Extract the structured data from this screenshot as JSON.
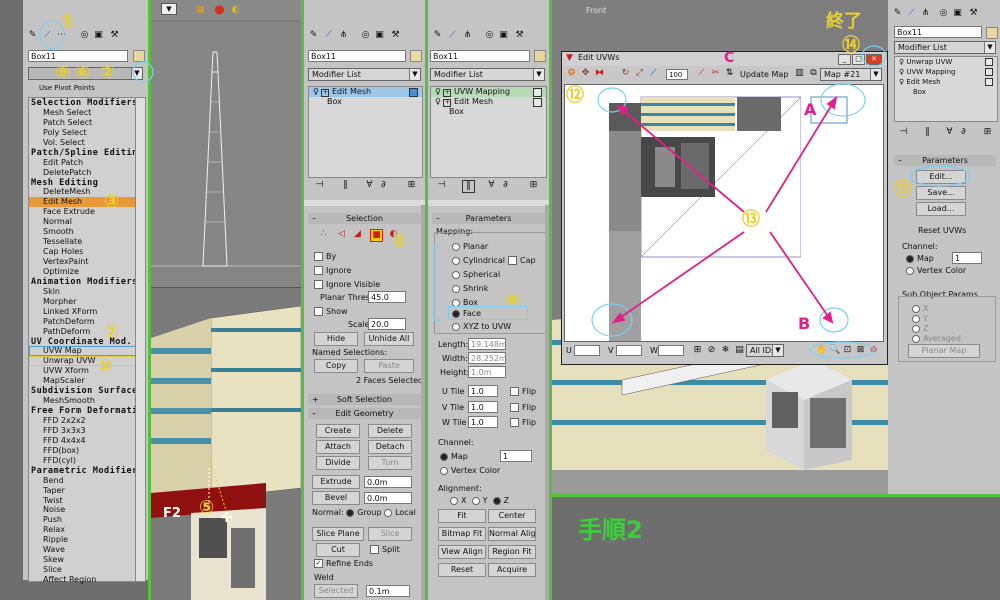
{
  "panel1": {
    "object_name": "Box11",
    "modifier_list": "",
    "pivot_button": "Use Pivot Points",
    "list_items": [
      {
        "label": "Selection Modifiers",
        "type": "header"
      },
      {
        "label": "Mesh Select",
        "type": "item"
      },
      {
        "label": "Patch Select",
        "type": "item"
      },
      {
        "label": "Poly Select",
        "type": "item"
      },
      {
        "label": "Vol. Select",
        "type": "item"
      },
      {
        "label": "Patch/Spline Editing",
        "type": "header"
      },
      {
        "label": "Edit Patch",
        "type": "item"
      },
      {
        "label": "DeletePatch",
        "type": "item"
      },
      {
        "label": "Mesh Editing",
        "type": "header"
      },
      {
        "label": "DeleteMesh",
        "type": "item"
      },
      {
        "label": "Edit Mesh",
        "type": "selected"
      },
      {
        "label": "Face Extrude",
        "type": "item"
      },
      {
        "label": "Normal",
        "type": "item"
      },
      {
        "label": "Smooth",
        "type": "item"
      },
      {
        "label": "Tessellate",
        "type": "item"
      },
      {
        "label": "Cap Holes",
        "type": "item"
      },
      {
        "label": "VertexPaint",
        "type": "item"
      },
      {
        "label": "Optimize",
        "type": "item"
      },
      {
        "label": "Animation Modifiers",
        "type": "header"
      },
      {
        "label": "Skin",
        "type": "item"
      },
      {
        "label": "Morpher",
        "type": "item"
      },
      {
        "label": "Linked XForm",
        "type": "item"
      },
      {
        "label": "PatchDeform",
        "type": "item"
      },
      {
        "label": "PathDeform",
        "type": "item"
      },
      {
        "label": "UV Coordinate Mod.",
        "type": "header"
      },
      {
        "label": "UVW Map",
        "type": "boxed"
      },
      {
        "label": "Unwrap UVW",
        "type": "boxed-yellow"
      },
      {
        "label": "UVW Xform",
        "type": "item"
      },
      {
        "label": "MapScaler",
        "type": "item"
      },
      {
        "label": "Subdivision Surfaces",
        "type": "header"
      },
      {
        "label": "MeshSmooth",
        "type": "item"
      },
      {
        "label": "Free Form Deformations",
        "type": "header"
      },
      {
        "label": "FFD 2x2x2",
        "type": "item"
      },
      {
        "label": "FFD 3x3x3",
        "type": "item"
      },
      {
        "label": "FFD 4x4x4",
        "type": "item"
      },
      {
        "label": "FFD(box)",
        "type": "item"
      },
      {
        "label": "FFD(cyl)",
        "type": "item"
      },
      {
        "label": "Parametric Modifiers",
        "type": "header"
      },
      {
        "label": "Bend",
        "type": "item"
      },
      {
        "label": "Taper",
        "type": "item"
      },
      {
        "label": "Twist",
        "type": "item"
      },
      {
        "label": "Noise",
        "type": "item"
      },
      {
        "label": "Push",
        "type": "item"
      },
      {
        "label": "Relax",
        "type": "item"
      },
      {
        "label": "Ripple",
        "type": "item"
      },
      {
        "label": "Wave",
        "type": "item"
      },
      {
        "label": "Skew",
        "type": "item"
      },
      {
        "label": "Slice",
        "type": "item"
      },
      {
        "label": "Affect Region",
        "type": "item"
      }
    ]
  },
  "panel3": {
    "object_name": "Box11",
    "modifier_list": "Modifier List",
    "stack": [
      "Edit Mesh",
      "Box"
    ],
    "selection_rollout": "Selection",
    "by_label": "By",
    "ignore_label": "Ignore",
    "ignore_visible_label": "Ignore Visible",
    "planar_thresh_label": "Planar Thresh",
    "planar_thresh_value": "45.0",
    "show_label": "Show",
    "scale_label": "Scale",
    "scale_value": "20.0",
    "hide": "Hide",
    "unhide_all": "Unhide All",
    "named_selections": "Named Selections:",
    "copy": "Copy",
    "paste": "Paste",
    "faces_selected": "2 Faces Selected",
    "soft_selection": "Soft Selection",
    "edit_geometry": "Edit Geometry",
    "create": "Create",
    "delete": "Delete",
    "attach": "Attach",
    "detach": "Detach",
    "divide": "Divide",
    "turn": "Turn",
    "extrude": "Extrude",
    "extrude_value": "0.0m",
    "bevel": "Bevel",
    "bevel_value": "0.0m",
    "normal_label": "Normal:",
    "group": "Group",
    "local": "Local",
    "slice_plane": "Slice Plane",
    "slice": "Slice",
    "cut": "Cut",
    "split": "Split",
    "refine_ends": "Refine Ends",
    "weld": "Weld",
    "selected": "Selected",
    "weld_value": "0.1m"
  },
  "panel4": {
    "object_name": "Box11",
    "modifier_list": "Modifier List",
    "stack": [
      "UVW Mapping",
      "Edit Mesh",
      "Box"
    ],
    "parameters": "Parameters",
    "mapping": "Mapping:",
    "planar": "Planar",
    "cylindrical": "Cylindrical",
    "cap": "Cap",
    "spherical": "Spherical",
    "shrink": "Shrink",
    "box": "Box",
    "face": "Face",
    "xyz_to_uvw": "XYZ to UVW",
    "length_label": "Length:",
    "length_value": "19.148m",
    "width_label": "Width:",
    "width_value": "28.252m",
    "height_label": "Height:",
    "height_value": "1.0m",
    "utile": "U Tile",
    "vtile": "V Tile",
    "wtile": "W Tile",
    "tile_value": "1.0",
    "flip": "Flip",
    "channel": "Channel:",
    "map": "Map",
    "map_value": "1",
    "vertex_color": "Vertex Color",
    "alignment": "Alignment:",
    "x": "X",
    "y": "Y",
    "z": "Z",
    "fit": "Fit",
    "center": "Center",
    "bitmap_fit": "Bitmap Fit",
    "normal_align": "Normal Align",
    "view_align": "View Align",
    "region_fit": "Region Fit",
    "reset": "Reset",
    "acquire": "Acquire"
  },
  "viewport5": {
    "label": "Front"
  },
  "unwrap": {
    "title": "Edit UVWs",
    "update_map": "Update Map",
    "map_dropdown": "Map #21",
    "zoom_value": "100",
    "u_label": "U",
    "v_label": "V",
    "w_label": "W",
    "all_ids": "All IDs"
  },
  "panel6": {
    "object_name": "Box11",
    "modifier_list": "Modifier List",
    "stack": [
      "Unwrap UVW",
      "UVW Mapping",
      "Edit Mesh",
      "Box"
    ],
    "parameters": "Parameters",
    "edit": "Edit...",
    "save": "Save...",
    "load": "Load...",
    "reset_uvws": "Reset UVWs",
    "channel": "Channel:",
    "map": "Map",
    "map_value": "1",
    "vertex_color": "Vertex Color",
    "sub_object_params": "Sub Object Params",
    "x": "X",
    "y": "Y",
    "z": "Z",
    "averaged": "Averaged",
    "planar_map": "Planar Map"
  },
  "annotations": {
    "n1": "①",
    "n2": "②",
    "n3": "③",
    "n4": "④",
    "n5": "⑤",
    "n6": "⑥",
    "n7": "⑦",
    "n8": "⑧",
    "n9": "⑨",
    "n10": "⑩",
    "n11": "⑪",
    "n12": "⑫",
    "n13": "⑬",
    "n14": "⑭",
    "end_label": "終了",
    "step_label": "手順2",
    "f2": "F2",
    "A": "A",
    "B": "B",
    "C": "C"
  },
  "colors": {
    "annotation_yellow": "#e8d030",
    "annotation_magenta": "#e0208a",
    "separator_green": "#55c040",
    "highlight_orange": "#e89a3a",
    "selection_cyan": "#7ad0f0"
  }
}
